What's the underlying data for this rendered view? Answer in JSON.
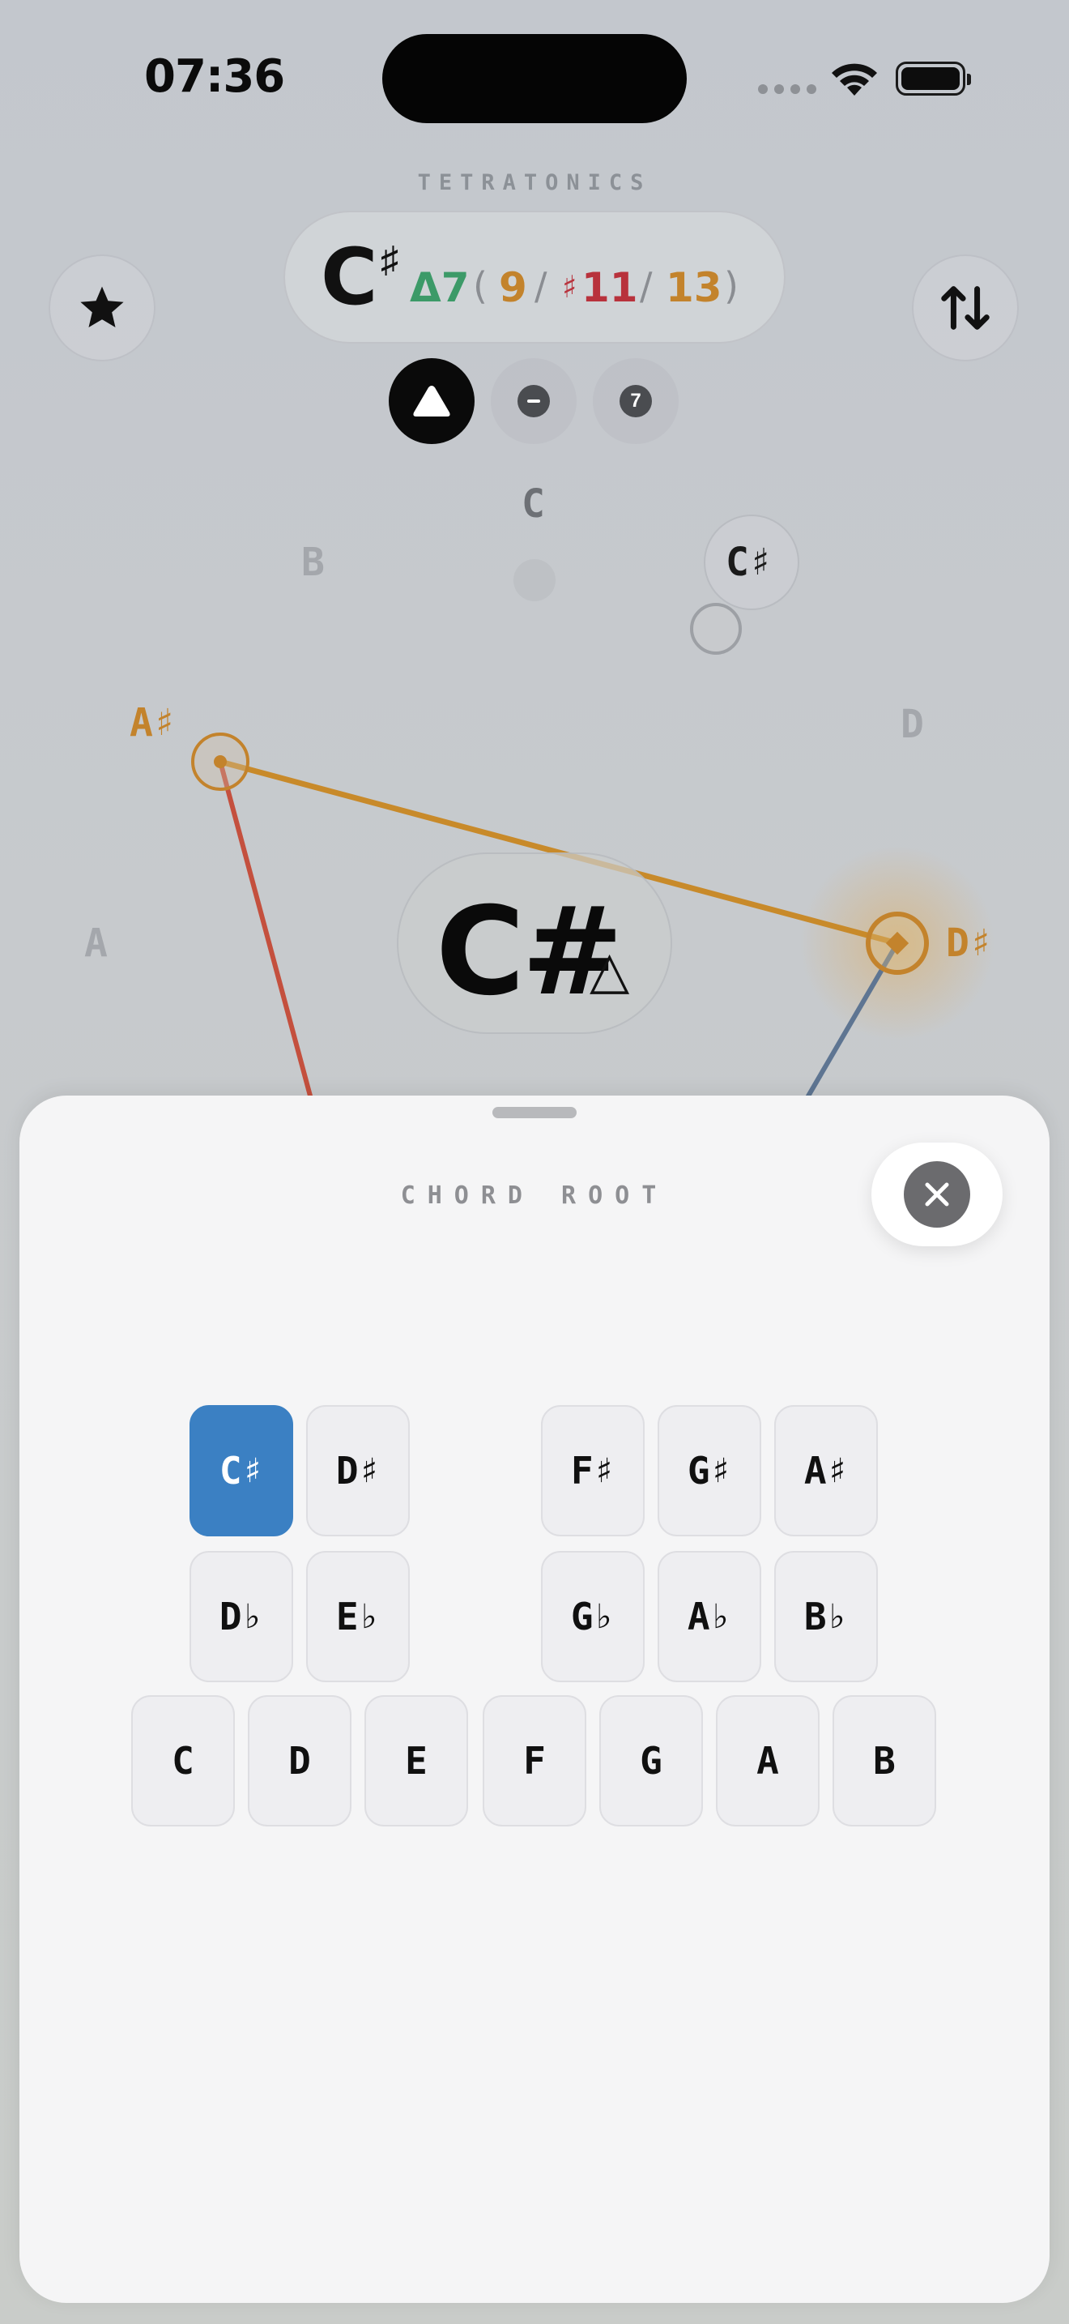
{
  "status": {
    "time": "07:36"
  },
  "app": {
    "title": "TETRATONICS"
  },
  "chord": {
    "root": "C",
    "root_sharp": "♯",
    "quality": "Δ7",
    "ext_open": "(",
    "ext_9": "9",
    "slash1": "/",
    "ext_11_sharp": "♯",
    "ext_11": "11",
    "slash2": "/",
    "ext_13": "13",
    "ext_close": ")",
    "center_root": "C#",
    "center_symbol": "△"
  },
  "modes": {
    "seventh_label": "7"
  },
  "wheel": {
    "notes": {
      "C": "C",
      "Csharp": "C♯",
      "D": "D",
      "Dsharp": "D♯",
      "B": "B",
      "Asharp": "A♯",
      "A": "A"
    }
  },
  "sheet": {
    "title": "CHORD ROOT",
    "sharps": [
      {
        "letter": "C",
        "acc": "♯",
        "selected": true
      },
      {
        "letter": "D",
        "acc": "♯"
      },
      {
        "letter": "F",
        "acc": "♯"
      },
      {
        "letter": "G",
        "acc": "♯"
      },
      {
        "letter": "A",
        "acc": "♯"
      }
    ],
    "flats": [
      {
        "letter": "D",
        "acc": "♭"
      },
      {
        "letter": "E",
        "acc": "♭"
      },
      {
        "letter": "G",
        "acc": "♭"
      },
      {
        "letter": "A",
        "acc": "♭"
      },
      {
        "letter": "B",
        "acc": "♭"
      }
    ],
    "naturals": [
      "C",
      "D",
      "E",
      "F",
      "G",
      "A",
      "B"
    ]
  },
  "colors": {
    "quality_green": "#3c9a68",
    "ext_gold": "#c3832c",
    "ext_red": "#b8323c",
    "selected_blue": "#3b80c3",
    "line_gold": "#c88a2a",
    "line_red": "#c4503e",
    "line_blue": "#5e7592"
  },
  "icons": [
    "star-icon",
    "swap-vertical-icon",
    "triangle-icon",
    "minus-icon",
    "close-icon",
    "wifi-icon",
    "battery-icon"
  ]
}
